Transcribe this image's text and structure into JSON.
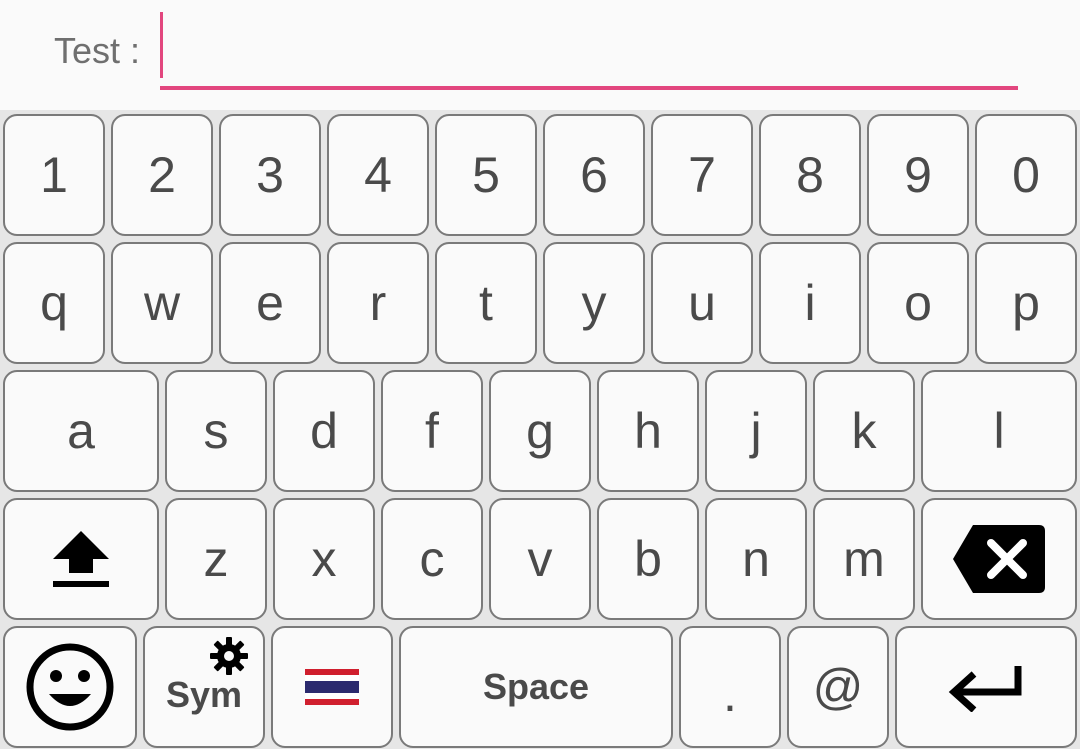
{
  "field": {
    "label": "Test :",
    "value": ""
  },
  "keyboard": {
    "row1": [
      "1",
      "2",
      "3",
      "4",
      "5",
      "6",
      "7",
      "8",
      "9",
      "0"
    ],
    "row2": [
      "q",
      "w",
      "e",
      "r",
      "t",
      "y",
      "u",
      "i",
      "o",
      "p"
    ],
    "row3": [
      "a",
      "s",
      "d",
      "f",
      "g",
      "h",
      "j",
      "k",
      "l"
    ],
    "row4": [
      "z",
      "x",
      "c",
      "v",
      "b",
      "n",
      "m"
    ],
    "shift_icon": "shift-icon",
    "backspace_icon": "backspace-icon",
    "emoji_icon": "emoji-icon",
    "settings_icon": "gear-icon",
    "language_icon": "thai-flag-icon",
    "enter_icon": "enter-icon",
    "sym_label": "Sym",
    "space_label": "Space",
    "period_label": ".",
    "at_label": "@"
  },
  "colors": {
    "accent": "#e2467e",
    "key_bg": "#fafafa",
    "key_border": "#7a7a7a",
    "keyboard_bg": "#e6e6e6"
  }
}
